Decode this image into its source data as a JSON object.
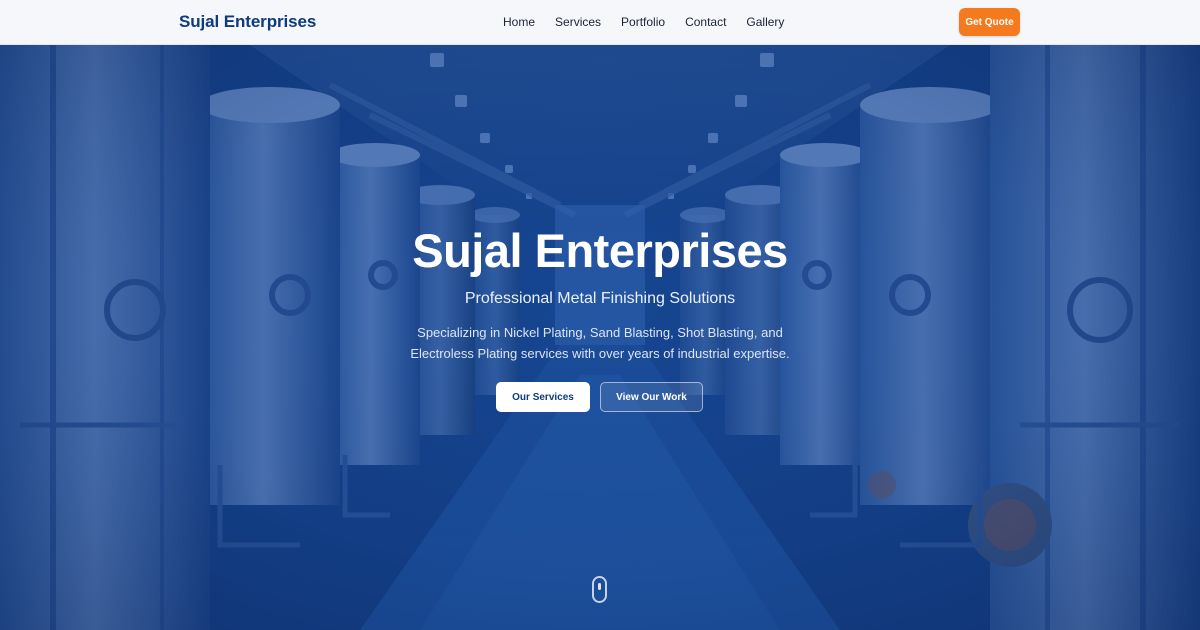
{
  "navbar": {
    "brand": "Sujal Enterprises",
    "links": [
      "Home",
      "Services",
      "Portfolio",
      "Contact",
      "Gallery"
    ],
    "cta_label": "Get Quote"
  },
  "hero": {
    "title": "Sujal Enterprises",
    "subtitle": "Professional Metal Finishing Solutions",
    "description": "Specializing in Nickel Plating, Sand Blasting, Shot Blasting, and Electroless Plating services with over years of industrial expertise.",
    "primary_button": "Our Services",
    "secondary_button": "View Our Work",
    "background_image": "industrial-tanks-corridor"
  },
  "icons": {
    "scroll": "mouse-scroll-icon"
  },
  "colors": {
    "brand_blue": "#0e3a7e",
    "accent_orange": "#f57a1d",
    "hero_overlay": "#123e86",
    "navbar_bg": "#f5f7fb"
  }
}
